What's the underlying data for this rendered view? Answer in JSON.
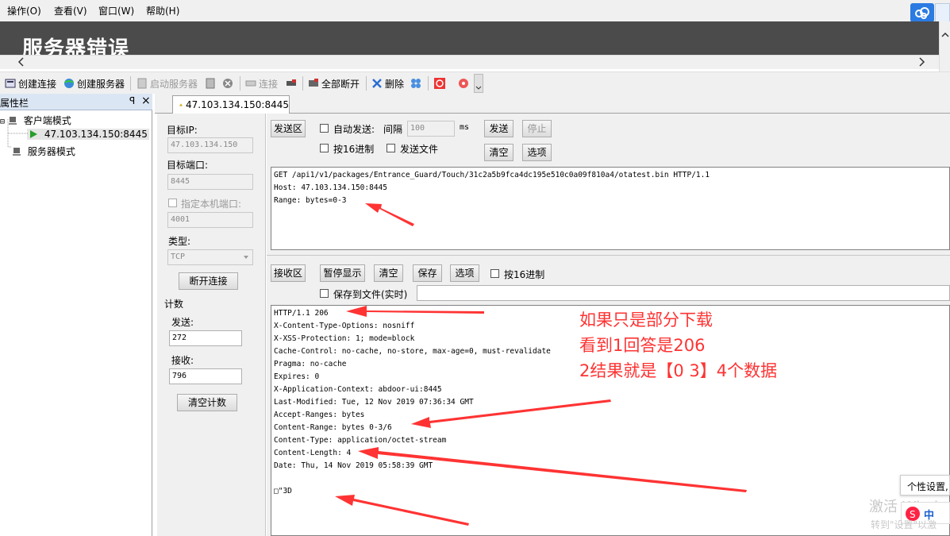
{
  "menu": {
    "items": [
      "操作(O)",
      "查看(V)",
      "窗口(W)",
      "帮助(H)"
    ]
  },
  "banner": {
    "title": "服务器错误"
  },
  "toolbar": {
    "create_connection": "创建连接",
    "create_server": "创建服务器",
    "start_server": "启动服务器",
    "connect": "连接",
    "disconnect_all": "全部断开",
    "delete": "删除"
  },
  "left_panel": {
    "title": "属性栏",
    "pin": "ᵖ",
    "close": "×",
    "tree": {
      "client_mode": "客户端模式",
      "connection": "47.103.134.150:8445",
      "server_mode": "服务器模式"
    }
  },
  "tab": {
    "label": "47.103.134.150:8445"
  },
  "settings": {
    "target_ip_label": "目标IP:",
    "target_ip": "47.103.134.150",
    "target_port_label": "目标端口:",
    "target_port": "8445",
    "local_port_label": "指定本机端口:",
    "local_port": "4001",
    "type_label": "类型:",
    "type_value": "TCP",
    "disconnect_button": "断开连接",
    "count_label": "计数",
    "send_label": "发送:",
    "send_count": "272",
    "recv_label": "接收:",
    "recv_count": "796",
    "clear_count_button": "清空计数"
  },
  "send": {
    "area_label": "发送区",
    "auto_send": "自动发送:",
    "interval_label": "间隔",
    "interval": "100",
    "interval_unit": "ms",
    "send_button": "发送",
    "stop_button": "停止",
    "hex_send": "按16进制",
    "send_file": "发送文件",
    "clear_button": "清空",
    "options_button": "选项",
    "content": "GET /api1/v1/packages/Entrance_Guard/Touch/31c2a5b9fca4dc195e510c0a09f810a4/otatest.bin HTTP/1.1\nHost: 47.103.134.150:8445\nRange: bytes=0-3"
  },
  "receive": {
    "area_label": "接收区",
    "pause_button": "暂停显示",
    "clear_button": "清空",
    "save_button": "保存",
    "options_button": "选项",
    "hex_recv": "按16进制",
    "save_to_file": "保存到文件(实时)",
    "content": "HTTP/1.1 206\nX-Content-Type-Options: nosniff\nX-XSS-Protection: 1; mode=block\nCache-Control: no-cache, no-store, max-age=0, must-revalidate\nPragma: no-cache\nExpires: 0\nX-Application-Context: abdoor-ui:8445\nLast-Modified: Tue, 12 Nov 2019 07:36:34 GMT\nAccept-Ranges: bytes\nContent-Range: bytes 0-3/6\nContent-Type: application/octet-stream\nContent-Length: 4\nDate: Thu, 14 Nov 2019 05:58:39 GMT\n\n□\"3D"
  },
  "annotation": {
    "line1": "如果只是部分下载",
    "line2": "看到1回答是206",
    "line3": "2结果就是【0 3】4个数据"
  },
  "overlay": {
    "popup": "个性设置,",
    "watermark": "激活 Windo",
    "watermark_sub": "转到\"设置\"以激",
    "ime": "中"
  },
  "colors": {
    "banner": "#4b4b4b",
    "annotation": "#ff3333",
    "panel_bg": "#f0f0f0"
  }
}
